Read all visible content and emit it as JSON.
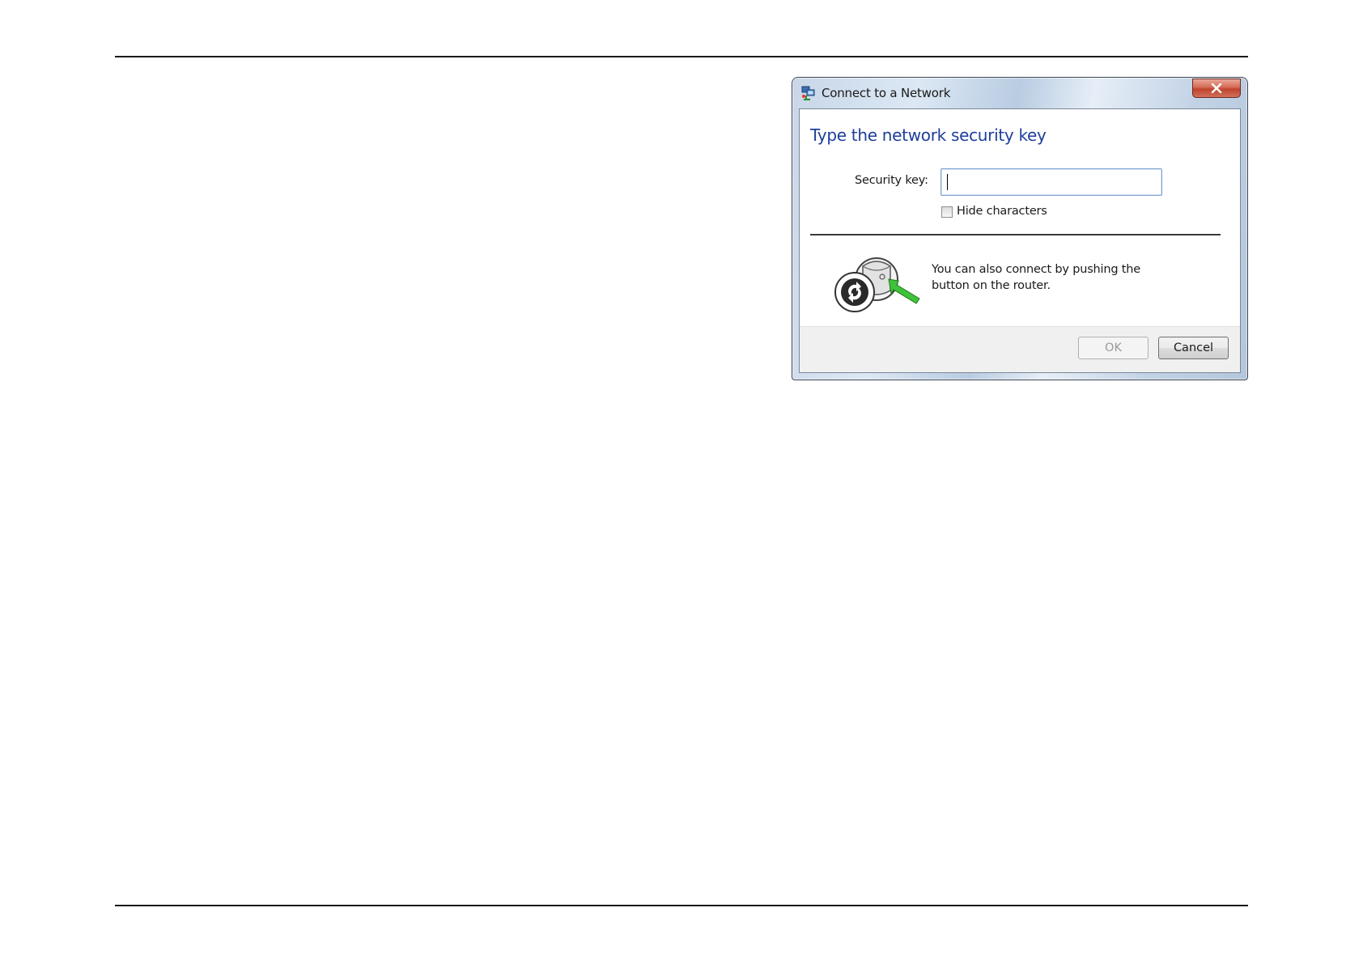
{
  "dialog": {
    "title": "Connect to a Network",
    "heading": "Type the network security key",
    "security_key_label": "Security key:",
    "security_key_value": "",
    "hide_characters_label": "Hide characters",
    "hide_characters_checked": false,
    "wps_message": "You can also connect by pushing the button on the router.",
    "buttons": {
      "ok": "OK",
      "cancel": "Cancel"
    }
  },
  "icons": {
    "title": "network-icon",
    "close": "close-icon",
    "wps": "wps-router-push-button-icon"
  },
  "colors": {
    "heading": "#1e3e9a",
    "close_button": "#c0432c",
    "wps_arrow": "#3fc23a"
  }
}
